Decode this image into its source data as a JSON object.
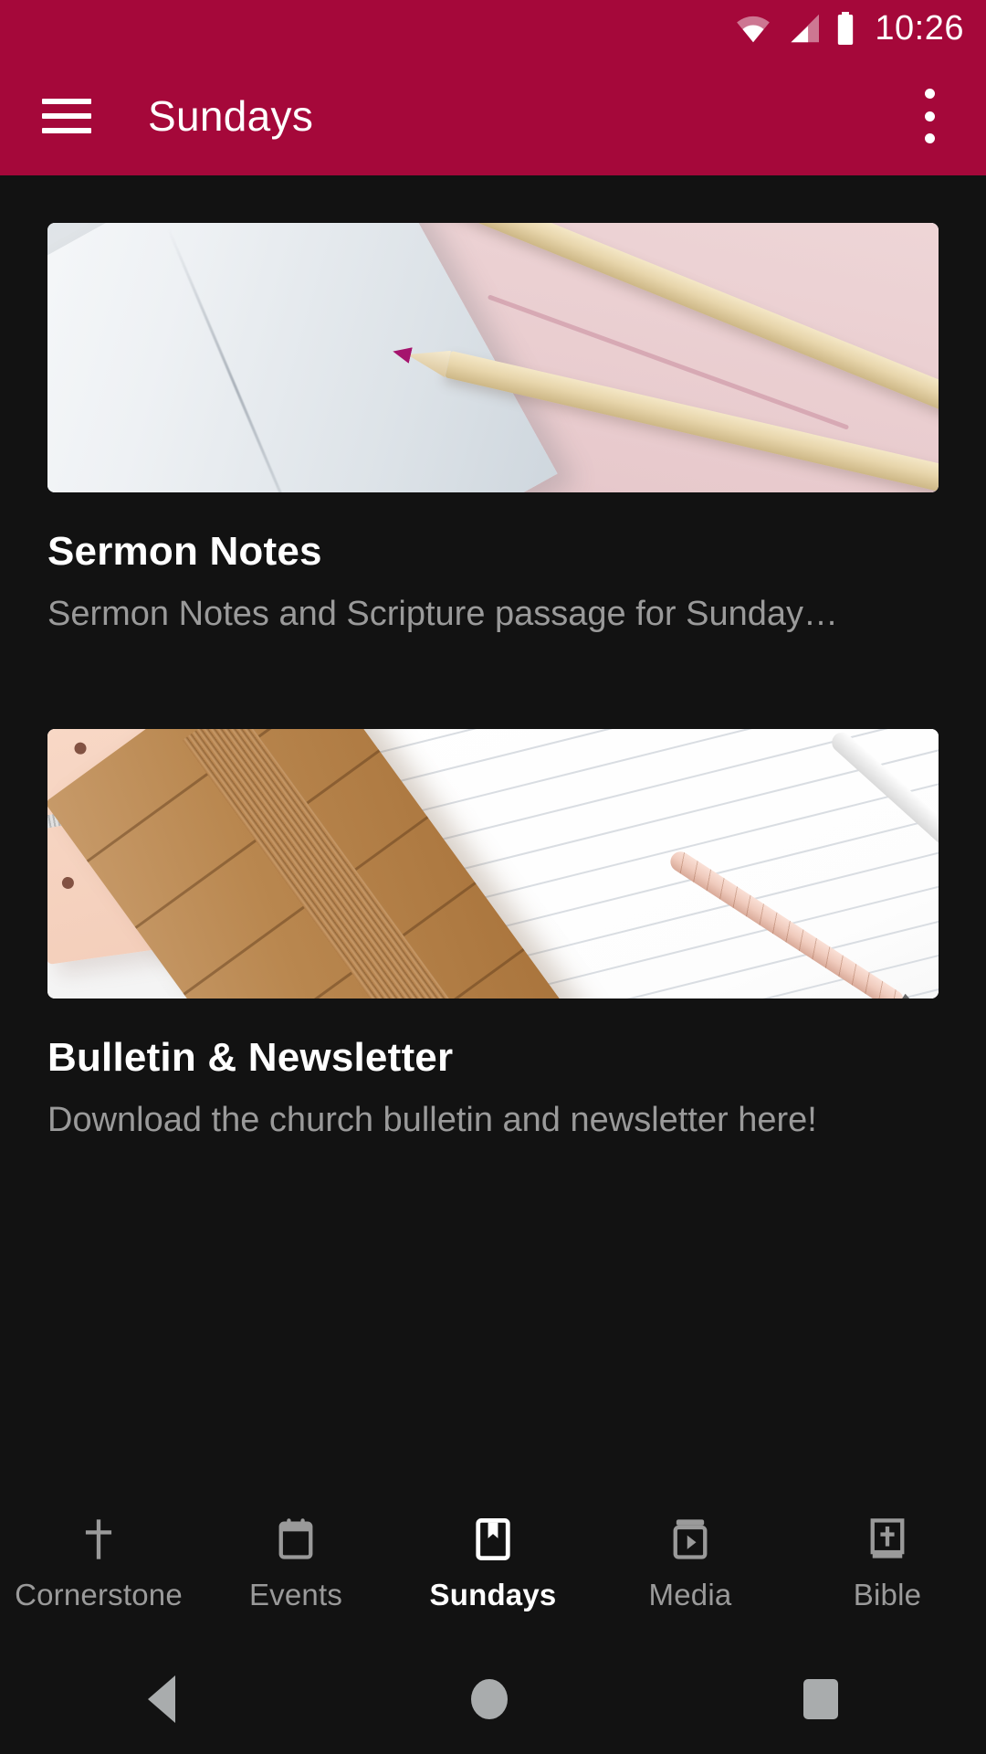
{
  "theme": {
    "accent": "#A5083A",
    "background": "#121212",
    "text_primary": "#FFFFFF",
    "text_secondary": "#9A9A9A"
  },
  "status_bar": {
    "time": "10:26",
    "icons": [
      "wifi-icon",
      "cellular-signal-icon",
      "battery-icon"
    ]
  },
  "app_bar": {
    "menu_icon": "hamburger-menu-icon",
    "title": "Sundays",
    "overflow_icon": "more-vertical-icon"
  },
  "cards": [
    {
      "title": "Sermon Notes",
      "subtitle": "Sermon Notes and Scripture passage for Sunday…",
      "image": "marble-notebook-and-colored-pencils-photo"
    },
    {
      "title": "Bulletin & Newsletter",
      "subtitle": "Download the church bulletin and newsletter here!",
      "image": "notebooks-and-pens-on-white-desk-photo"
    }
  ],
  "bottom_tabs": [
    {
      "label": "Cornerstone",
      "icon": "cross-icon",
      "active": false
    },
    {
      "label": "Events",
      "icon": "calendar-icon",
      "active": false
    },
    {
      "label": "Sundays",
      "icon": "bookmark-book-icon",
      "active": true
    },
    {
      "label": "Media",
      "icon": "play-media-icon",
      "active": false
    },
    {
      "label": "Bible",
      "icon": "bible-book-icon",
      "active": false
    }
  ],
  "system_nav": {
    "back": "back-triangle-icon",
    "home": "home-circle-icon",
    "recents": "recents-square-icon"
  }
}
